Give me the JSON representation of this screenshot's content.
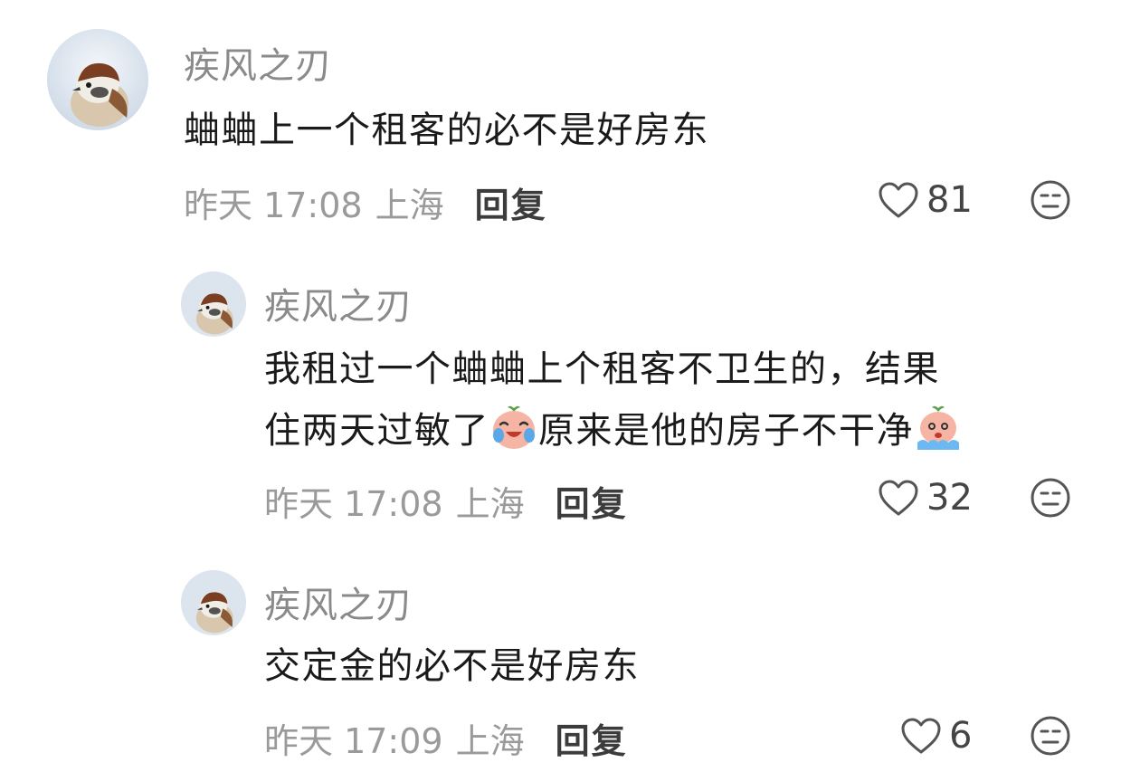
{
  "comments": [
    {
      "username": "疾风之刃",
      "avatar_icon": "sparrow-avatar",
      "content": "蛐蛐上一个租客的必不是好房东",
      "time": "昨天 17:08",
      "location": "上海",
      "reply_label": "回复",
      "likes": "81"
    },
    {
      "username": "疾风之刃",
      "avatar_icon": "sparrow-avatar",
      "content_line1": "我租过一个蛐蛐上个租客不卫生的，结果",
      "content_line2a": "住两天过敏了",
      "content_line2b": "原来是他的房子不干净",
      "emoji1": "crying-laughing-peach-emoji",
      "emoji2": "crying-peach-emoji",
      "time": "昨天 17:08",
      "location": "上海",
      "reply_label": "回复",
      "likes": "32"
    },
    {
      "username": "疾风之刃",
      "avatar_icon": "sparrow-avatar",
      "content": "交定金的必不是好房东",
      "time": "昨天 17:09",
      "location": "上海",
      "reply_label": "回复",
      "likes": "6"
    }
  ],
  "icons": {
    "like": "heart-outline-icon",
    "dislike": "unhappy-face-icon"
  },
  "colors": {
    "username": "#8a8a8a",
    "meta": "#9a9a9a",
    "reply": "#3c3c3c",
    "text": "#1a1a1a"
  }
}
